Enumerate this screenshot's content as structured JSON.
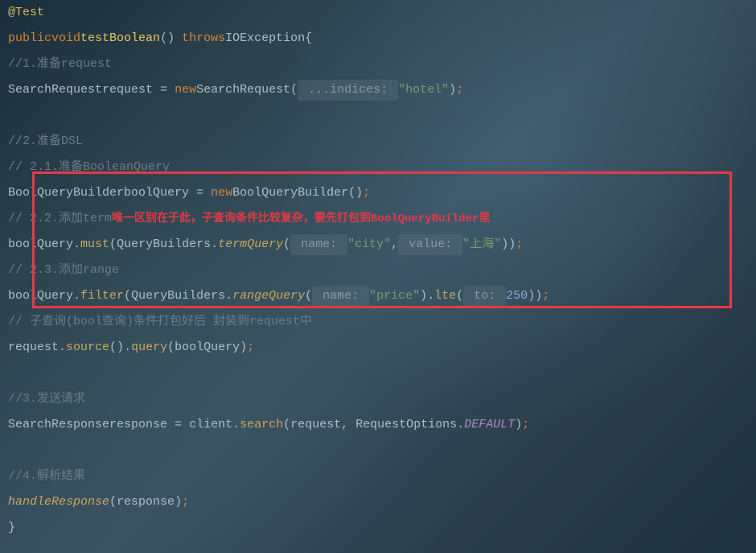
{
  "lines": {
    "l1_annotation": "@Test",
    "l2_public": "public",
    "l2_void": "void",
    "l2_method": "testBoolean",
    "l2_throws": "throws",
    "l2_exception": "IOException",
    "l3_comment": "//1.准备request",
    "l4_type": "SearchRequest",
    "l4_var": "request",
    "l4_new": "new",
    "l4_ctor": "SearchRequest",
    "l4_hint": " ...indices: ",
    "l4_string": "\"hotel\"",
    "l5_comment": "//2.准备DSL",
    "l6_comment": "// 2.1.准备BooleanQuery",
    "l7_type": "BoolQueryBuilder",
    "l7_var": "boolQuery",
    "l7_new": "new",
    "l7_ctor": "BoolQueryBuilder",
    "l8_comment": "// 2.2.添加term",
    "l8_red": "唯一区别在于此，子查询条件比较复杂，要先打包到BoolQueryBuilder里",
    "l9_var": "boolQuery",
    "l9_must": "must",
    "l9_qb": "QueryBuilders",
    "l9_term": "termQuery",
    "l9_hint1": " name: ",
    "l9_str1": "\"city\"",
    "l9_hint2": " value: ",
    "l9_str2": "\"上海\"",
    "l10_comment": "// 2.3.添加range",
    "l11_var": "boolQuery",
    "l11_filter": "filter",
    "l11_qb": "QueryBuilders",
    "l11_range": "rangeQuery",
    "l11_hint1": " name: ",
    "l11_str1": "\"price\"",
    "l11_lte": "lte",
    "l11_hint2": " to: ",
    "l11_num": "250",
    "l12_comment": "// 子查询(bool查询)条件打包好后 封装到request中",
    "l13_req": "request",
    "l13_source": "source",
    "l13_query": "query",
    "l13_arg": "boolQuery",
    "l14_comment": "//3.发送请求",
    "l15_type": "SearchResponse",
    "l15_var": "response",
    "l15_client": "client",
    "l15_search": "search",
    "l15_arg1": "request",
    "l15_ro": "RequestOptions",
    "l15_default": "DEFAULT",
    "l16_comment": "//4.解析结果",
    "l17_method": "handleResponse",
    "l17_arg": "response"
  }
}
